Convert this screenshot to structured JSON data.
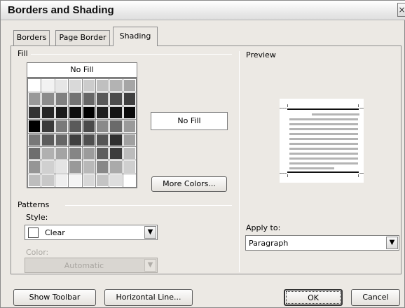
{
  "dialog": {
    "title": "Borders and Shading",
    "close_icon": "×"
  },
  "tabs": [
    {
      "label": "Borders",
      "active": false
    },
    {
      "label": "Page Border",
      "active": false
    },
    {
      "label": "Shading",
      "active": true
    }
  ],
  "fill": {
    "group_label": "Fill",
    "no_fill_label": "No Fill",
    "selected_label": "No Fill",
    "more_colors_label": "More Colors...",
    "palette_rows": [
      [
        "#ffffff",
        "#f2f2f2",
        "#e6e6e6",
        "#d9d9d9",
        "#cccccc",
        "#c0c0c0",
        "#b3b3b3",
        "#a6a6a6"
      ],
      [
        "#999999",
        "#8c8c8c",
        "#808080",
        "#737373",
        "#666666",
        "#595959",
        "#4d4d4d",
        "#404040"
      ],
      [
        "#333333",
        "#262626",
        "#1a1a1a",
        "#0d0d0d",
        "#000000",
        "#1f1f1f",
        "#141414",
        "#0a0a0a"
      ],
      [
        "#000000",
        "#3a3a3a",
        "#7a7a7a",
        "#5a5a5a",
        "#4a4a4a",
        "#8a8a8a",
        "#6a6a6a",
        "#9a9a9a"
      ],
      [
        "#787878",
        "#5c5c5c",
        "#666666",
        "#3f3f3f",
        "#4f4f4f",
        "#555555",
        "#2f2f2f",
        "#a0a0a0"
      ],
      [
        "#6e6e6e",
        "#b0b0b0",
        "#a4a4a4",
        "#858585",
        "#9c9c9c",
        "#5e5e5e",
        "#3c3c3c",
        "#bcbcbc"
      ],
      [
        "#959595",
        "#d0d0d0",
        "#e4e4e4",
        "#999999",
        "#b8b8b8",
        "#888888",
        "#aaaaaa",
        "#cfcfcf"
      ],
      [
        "#bdbdbd",
        "#c8c8c8",
        "#efefef",
        "#f4f4f4",
        "#d8d8d8",
        "#c4c4c4",
        "#dedede",
        "#ffffff"
      ]
    ]
  },
  "patterns": {
    "group_label": "Patterns",
    "style_label": "Style:",
    "style_value": "Clear",
    "color_label": "Color:",
    "color_value": "Automatic"
  },
  "preview": {
    "label": "Preview",
    "apply_to_label": "Apply to:",
    "apply_to_value": "Paragraph"
  },
  "footer": {
    "show_toolbar_label": "Show Toolbar",
    "horizontal_line_label": "Horizontal Line...",
    "ok_label": "OK",
    "cancel_label": "Cancel"
  },
  "icons": {
    "dropdown_arrow": "▼",
    "close": "close-icon",
    "chevron": "chevron-down-icon"
  }
}
